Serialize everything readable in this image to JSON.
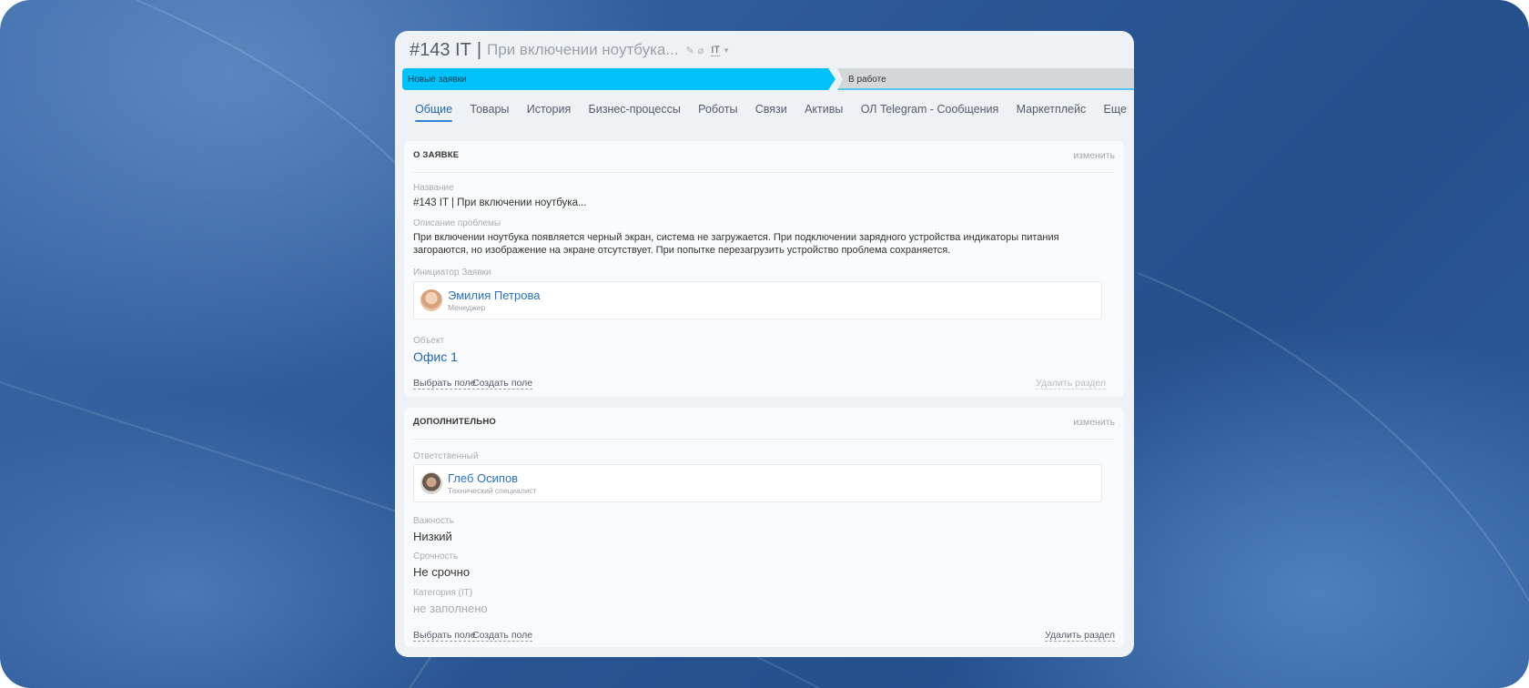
{
  "header": {
    "id": "#143 IT",
    "separator": "|",
    "title": "При включении ноутбука...",
    "category": "IT"
  },
  "stages": [
    {
      "label": "Новые заявки",
      "color": "#00c2fa"
    },
    {
      "label": "В работе",
      "color": "#d4d7da"
    }
  ],
  "tabs": [
    "Общие",
    "Товары",
    "История",
    "Бизнес-процессы",
    "Роботы",
    "Связи",
    "Активы",
    "ОЛ Telegram - Сообщения",
    "Маркетплейс",
    "Еще"
  ],
  "about": {
    "heading": "О ЗАЯВКЕ",
    "edit": "изменить",
    "name_label": "Название",
    "name_value": "#143 IT | При включении ноутбука...",
    "desc_label": "Описание проблемы",
    "desc_value": "При включении ноутбука появляется черный экран, система не загружается. При подключении зарядного устройства индикаторы питания загораются, но изображение на экране отсутствует. При попытке перезагрузить устройство проблема сохраняется.",
    "initiator_label": "Инициатор Заявки",
    "initiator": {
      "name": "Эмилия Петрова",
      "role": "Менеджер"
    },
    "object_label": "Объект",
    "object_value": "Офис 1",
    "select_field": "Выбрать поле",
    "create_field": "Создать поле",
    "delete_section": "Удалить раздел"
  },
  "extra": {
    "heading": "ДОПОЛНИТЕЛЬНО",
    "edit": "изменить",
    "responsible_label": "Ответственный",
    "responsible": {
      "name": "Глеб Осипов",
      "role": "Технический специалист"
    },
    "importance_label": "Важность",
    "importance_value": "Низкий",
    "urgency_label": "Срочность",
    "urgency_value": "Не срочно",
    "category_label": "Категория (IT)",
    "category_value": "не заполнено",
    "select_field": "Выбрать поле",
    "create_field": "Создать поле",
    "delete_section": "Удалить раздел"
  }
}
